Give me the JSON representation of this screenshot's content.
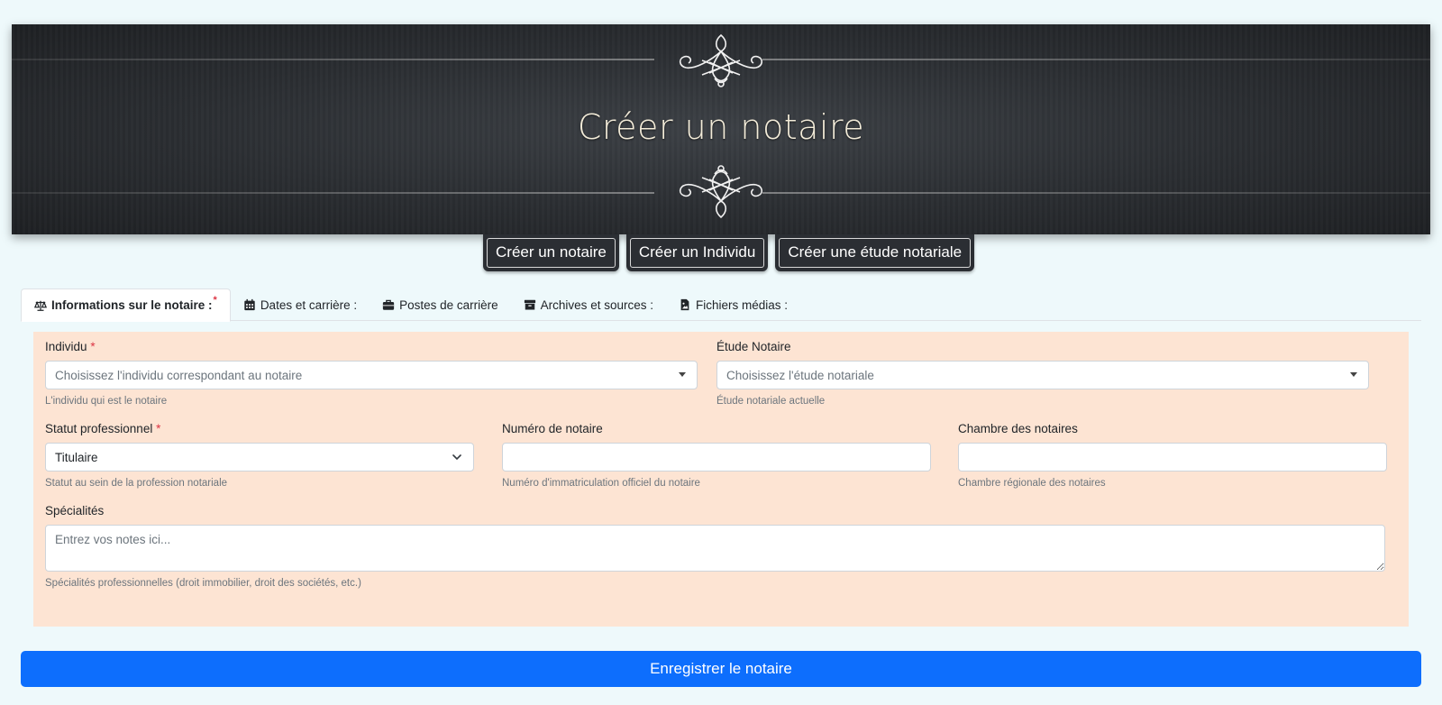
{
  "header": {
    "title": "Créer un notaire"
  },
  "nav_buttons": [
    {
      "label": "Créer un notaire"
    },
    {
      "label": "Créer un Individu"
    },
    {
      "label": "Créer une étude notariale"
    }
  ],
  "tabs": [
    {
      "label": "Informations sur le notaire :",
      "icon": "scale-icon",
      "active": true,
      "required_mark": "*"
    },
    {
      "label": "Dates et carrière :",
      "icon": "calendar-icon"
    },
    {
      "label": "Postes de carrière",
      "icon": "briefcase-icon"
    },
    {
      "label": "Archives et sources :",
      "icon": "archive-icon"
    },
    {
      "label": "Fichiers médias :",
      "icon": "file-image-icon"
    }
  ],
  "form": {
    "required_mark": "*",
    "individu": {
      "label": "Individu",
      "placeholder": "Choisissez l'individu correspondant au notaire",
      "help": "L'individu qui est le notaire"
    },
    "etude": {
      "label": "Étude Notaire",
      "placeholder": "Choisissez l'étude notariale",
      "help": "Étude notariale actuelle"
    },
    "statut": {
      "label": "Statut professionnel",
      "value": "Titulaire",
      "help": "Statut au sein de la profession notariale"
    },
    "numero": {
      "label": "Numéro de notaire",
      "value": "",
      "help": "Numéro d'immatriculation officiel du notaire"
    },
    "chambre": {
      "label": "Chambre des notaires",
      "value": "",
      "help": "Chambre régionale des notaires"
    },
    "specialites": {
      "label": "Spécialités",
      "placeholder": "Entrez vos notes ici...",
      "help": "Spécialités professionnelles (droit immobilier, droit des sociétés, etc.)"
    }
  },
  "submit": {
    "label": "Enregistrer le notaire"
  },
  "colors": {
    "page_bg": "#eef9fb",
    "banner_bg": "#2a2d31",
    "panel_bg": "#fde4d3",
    "primary": "#0d6efd",
    "required": "#dc3545"
  }
}
